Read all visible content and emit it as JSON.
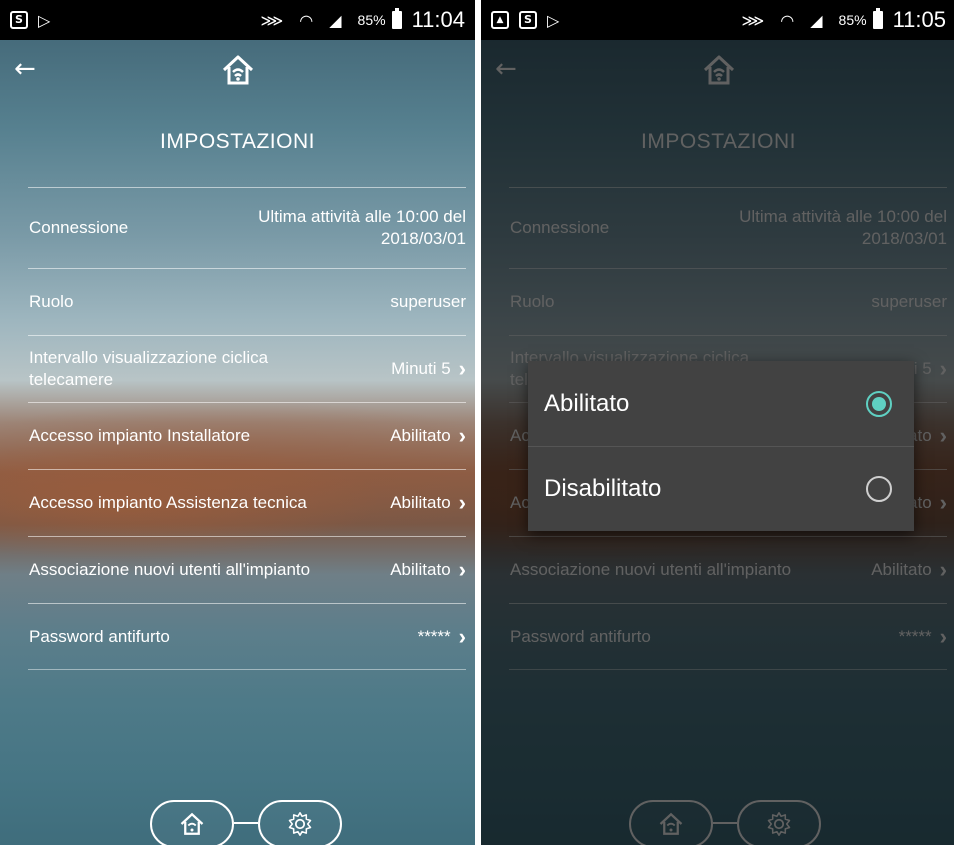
{
  "status_left": {
    "battery_text": "85%",
    "time": "11:04"
  },
  "status_right": {
    "battery_text": "85%",
    "time": "11:05"
  },
  "screen": {
    "title": "IMPOSTAZIONI",
    "rows": [
      {
        "label": "Connessione",
        "value": "Ultima attività alle 10:00 del 2018/03/01",
        "chevron": false
      },
      {
        "label": "Ruolo",
        "value": "superuser",
        "chevron": false
      },
      {
        "label": "Intervallo visualizzazione ciclica telecamere",
        "value": "Minuti 5",
        "chevron": true
      },
      {
        "label": "Accesso impianto Installatore",
        "value": "Abilitato",
        "chevron": true
      },
      {
        "label": "Accesso impianto Assistenza tecnica",
        "value": "Abilitato",
        "chevron": true
      },
      {
        "label": "Associazione nuovi utenti all'impianto",
        "value": "Abilitato",
        "chevron": true
      },
      {
        "label": "Password antifurto",
        "value": "*****",
        "chevron": true
      }
    ]
  },
  "dialog": {
    "options": [
      {
        "label": "Abilitato",
        "selected": true
      },
      {
        "label": "Disabilitato",
        "selected": false
      }
    ],
    "accent_color": "#5fd0c2"
  },
  "icons": {
    "back": "arrow-left-icon",
    "home": "house-wifi-icon",
    "settings": "gear-icon",
    "chevron": "chevron-right-icon"
  }
}
